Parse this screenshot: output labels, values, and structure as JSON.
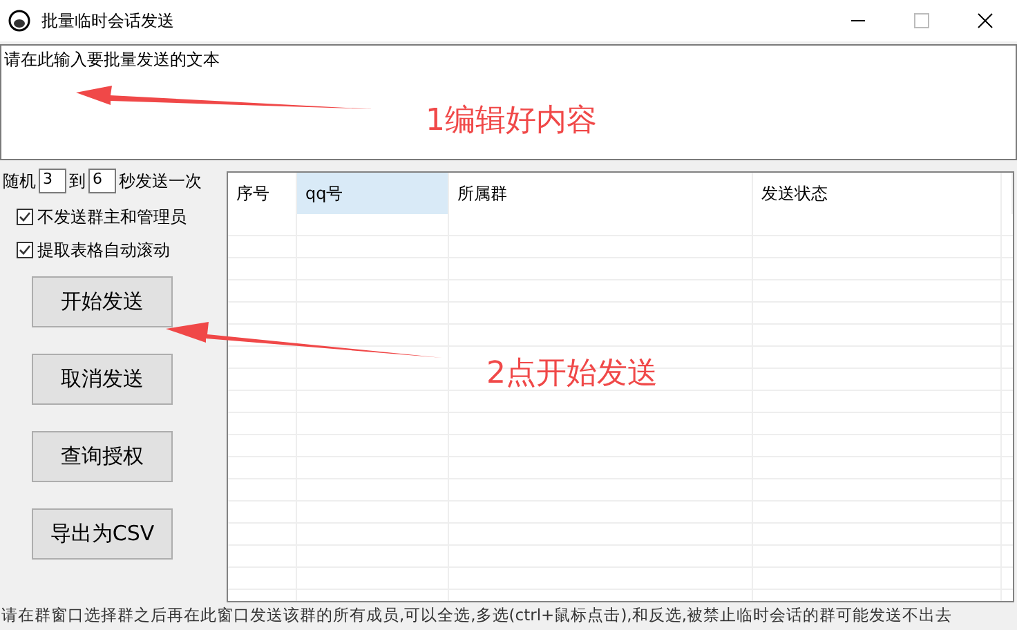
{
  "window": {
    "title": "批量临时会话发送"
  },
  "message_box": {
    "value": "请在此输入要批量发送的文本"
  },
  "interval": {
    "prefix": "随机",
    "from": "3",
    "middle": "到",
    "to": "6",
    "suffix": "秒发送一次"
  },
  "checkboxes": [
    {
      "label": "不发送群主和管理员",
      "checked": true
    },
    {
      "label": "提取表格自动滚动",
      "checked": true
    }
  ],
  "buttons": [
    "开始发送",
    "取消发送",
    "查询授权",
    "导出为CSV"
  ],
  "table": {
    "columns": [
      {
        "label": "序号",
        "selected": false
      },
      {
        "label": "qq号",
        "selected": true
      },
      {
        "label": "所属群",
        "selected": false
      },
      {
        "label": "发送状态",
        "selected": false
      }
    ]
  },
  "annotations": [
    "1编辑好内容",
    "2点开始发送"
  ],
  "status_text": "请在群窗口选择群之后再在此窗口发送该群的所有成员,可以全选,多选(ctrl+鼠标点击),和反选,被禁止临时会话的群可能发送不出去"
}
